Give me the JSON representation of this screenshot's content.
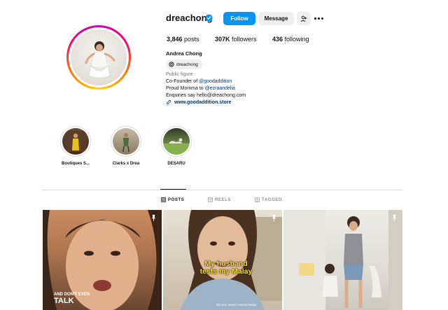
{
  "profile": {
    "username": "dreachong",
    "full_name": "Andrea Chong",
    "threads_handle": "dreachong",
    "category": "Public figure",
    "bio": {
      "line1_prefix": "Co-Founder of ",
      "line1_mention": "@goodaddition",
      "line2_prefix": "Proud Momma to ",
      "line2_mention": "@ezraandelia",
      "line3": "Enquiries say hello@dreachong.com"
    },
    "link": "www.goodaddition.store",
    "verified_icon": "verified-badge-icon"
  },
  "actions": {
    "follow_label": "Follow",
    "message_label": "Message",
    "add_user_icon": "add-user-icon",
    "more_icon": "more-options-icon"
  },
  "stats": {
    "posts_count": "3,846",
    "posts_label": "posts",
    "followers_count": "307K",
    "followers_label": "followers",
    "following_count": "436",
    "following_label": "following"
  },
  "highlights": [
    {
      "label": "Boutiques S..."
    },
    {
      "label": "Clarks x Drea"
    },
    {
      "label": "DESARU"
    }
  ],
  "tabs": [
    {
      "label": "POSTS",
      "icon": "grid-icon",
      "active": true
    },
    {
      "label": "REELS",
      "icon": "reels-icon",
      "active": false
    },
    {
      "label": "TAGGED",
      "icon": "tagged-icon",
      "active": false
    }
  ],
  "posts": [
    {
      "caption_small": "AND DON'T EVEN",
      "caption_big": "TALK",
      "pinned": true
    },
    {
      "caption_line1": "My husband",
      "caption_line2": "tests my Malay",
      "credit": "My Son doesn't speak Malay",
      "pinned": true
    },
    {
      "pinned": true
    }
  ],
  "colors": {
    "accent_blue": "#0095f6",
    "link_blue": "#00376b",
    "caption_yellow": "#f8e13a",
    "muted_gray": "#737373"
  }
}
